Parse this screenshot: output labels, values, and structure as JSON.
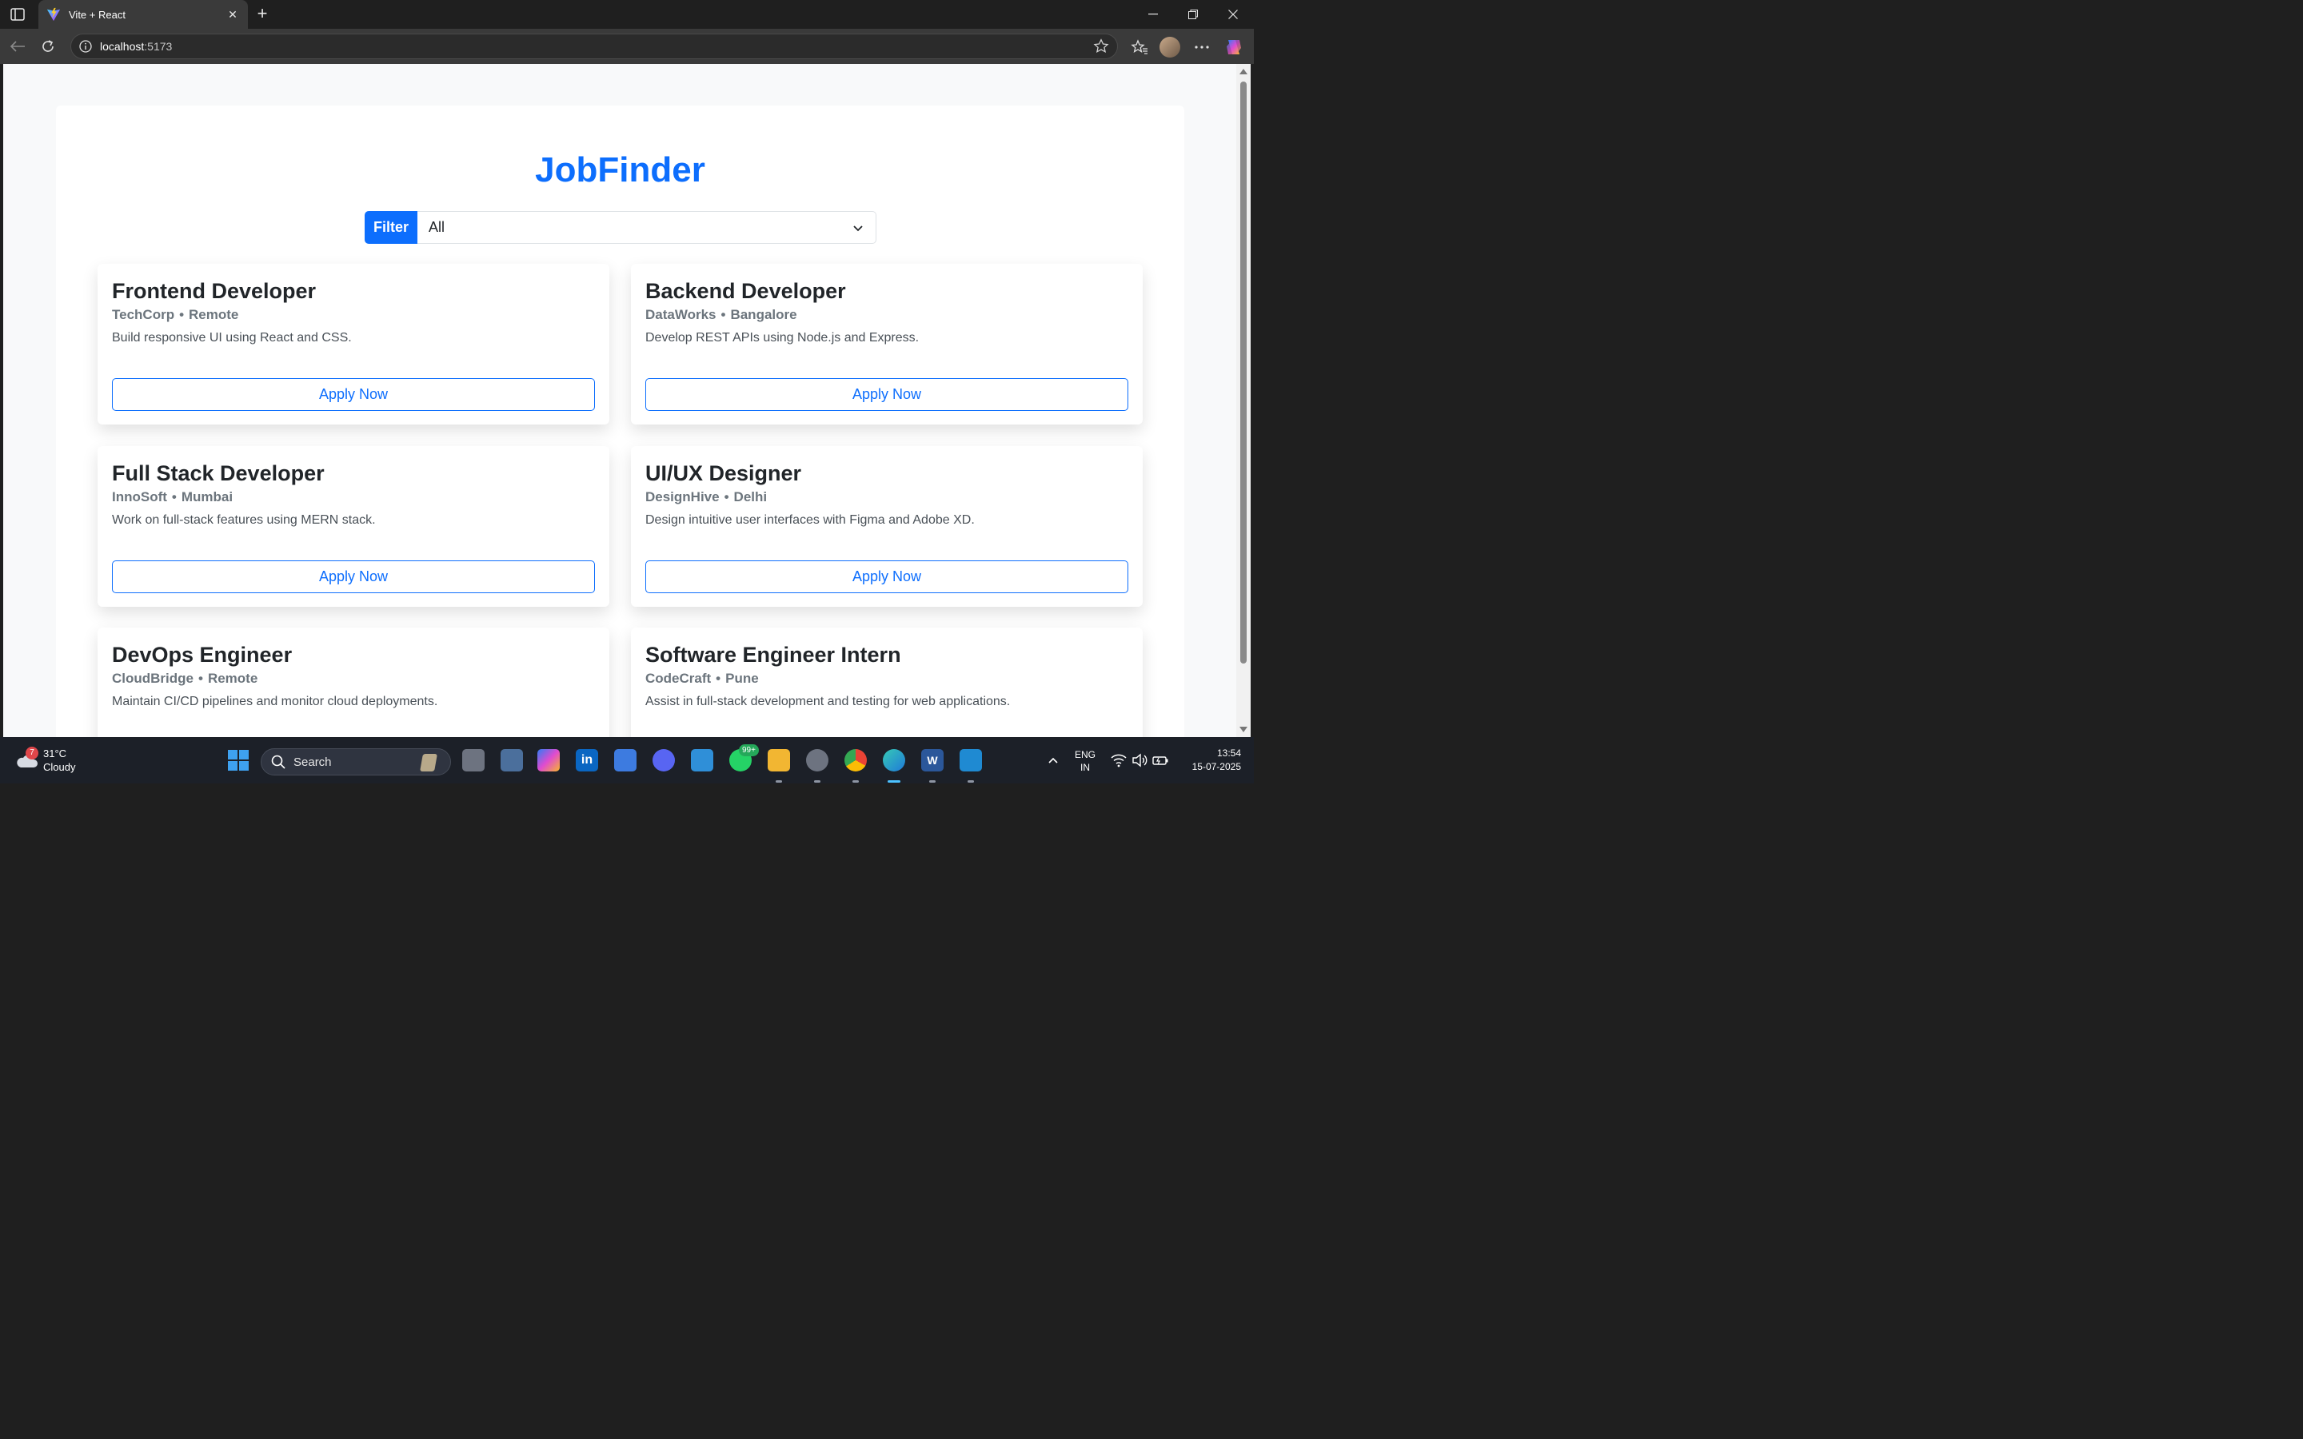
{
  "browser": {
    "tab_title": "Vite + React",
    "url_host": "localhost",
    "url_port": ":5173"
  },
  "app": {
    "title": "JobFinder",
    "filter_label": "Filter",
    "filter_value": "All",
    "apply_label": "Apply Now",
    "jobs": [
      {
        "title": "Frontend Developer",
        "company": "TechCorp",
        "location": "Remote",
        "description": "Build responsive UI using React and CSS."
      },
      {
        "title": "Backend Developer",
        "company": "DataWorks",
        "location": "Bangalore",
        "description": "Develop REST APIs using Node.js and Express."
      },
      {
        "title": "Full Stack Developer",
        "company": "InnoSoft",
        "location": "Mumbai",
        "description": "Work on full-stack features using MERN stack."
      },
      {
        "title": "UI/UX Designer",
        "company": "DesignHive",
        "location": "Delhi",
        "description": "Design intuitive user interfaces with Figma and Adobe XD."
      },
      {
        "title": "DevOps Engineer",
        "company": "CloudBridge",
        "location": "Remote",
        "description": "Maintain CI/CD pipelines and monitor cloud deployments."
      },
      {
        "title": "Software Engineer Intern",
        "company": "CodeCraft",
        "location": "Pune",
        "description": "Assist in full-stack development and testing for web applications."
      }
    ],
    "separator": "•"
  },
  "taskbar": {
    "weather_temp": "31°C",
    "weather_desc": "Cloudy",
    "weather_badge": "7",
    "search_label": "Search",
    "whatsapp_badge": "99+",
    "lang_line1": "ENG",
    "lang_line2": "IN",
    "time": "13:54",
    "date": "15-07-2025"
  },
  "colors": {
    "primary": "#0d6efd",
    "text_dark": "#212529",
    "text_muted": "#6c757d"
  }
}
